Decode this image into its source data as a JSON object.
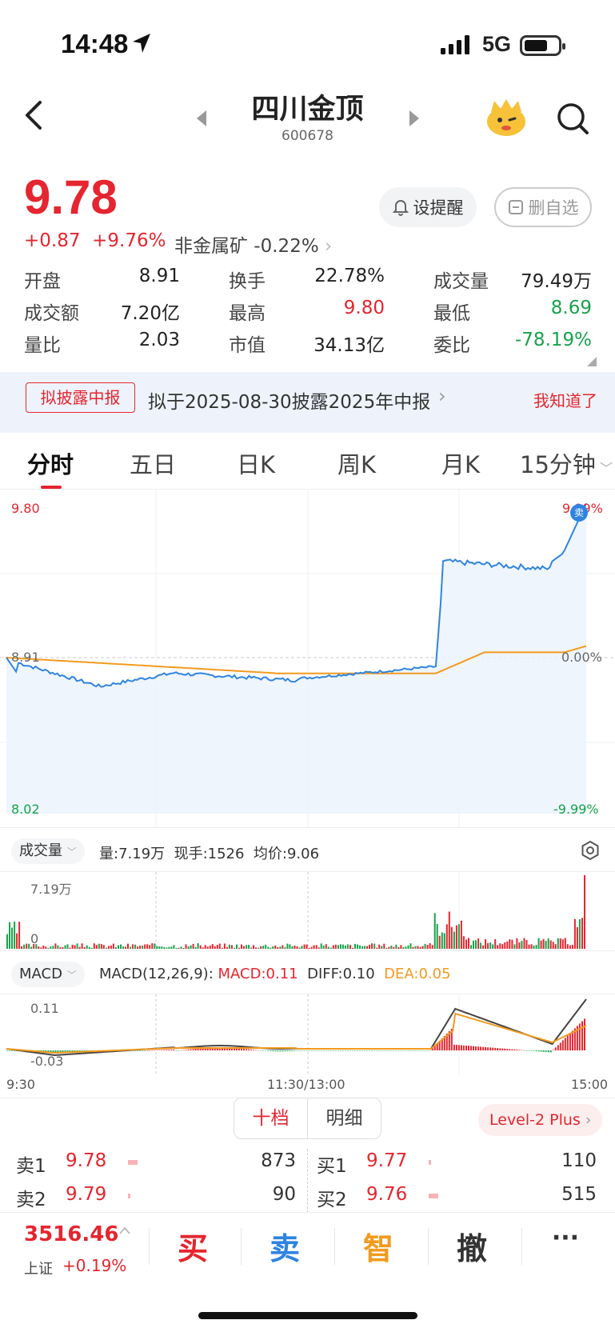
{
  "status": {
    "time": "14:48",
    "network": "5G"
  },
  "header": {
    "name": "四川金顶",
    "code": "600678"
  },
  "quote": {
    "price": "9.78",
    "change": "+0.87",
    "change_pct": "+9.76%",
    "sector": "非金属矿 -0.22%",
    "alert_label": "设提醒",
    "watch_label": "删自选"
  },
  "stats": [
    [
      {
        "label": "开盘",
        "value": "8.91",
        "color": "black"
      },
      {
        "label": "换手",
        "value": "22.78%",
        "color": "black"
      },
      {
        "label": "成交量",
        "value": "79.49万",
        "color": "black"
      }
    ],
    [
      {
        "label": "成交额",
        "value": "7.20亿",
        "color": "black"
      },
      {
        "label": "最高",
        "value": "9.80",
        "color": "red"
      },
      {
        "label": "最低",
        "value": "8.69",
        "color": "green"
      }
    ],
    [
      {
        "label": "量比",
        "value": "2.03",
        "color": "black"
      },
      {
        "label": "市值",
        "value": "34.13亿",
        "color": "black"
      },
      {
        "label": "委比",
        "value": "-78.19%",
        "color": "green"
      }
    ]
  ],
  "notice": {
    "badge": "拟披露中报",
    "text": "拟于2025-08-30披露2025年中报",
    "dismiss": "我知道了"
  },
  "tabs": [
    "分时",
    "五日",
    "日K",
    "周K",
    "月K",
    "15分钟"
  ],
  "chart": {
    "price_top": "9.80",
    "price_mid": "8.91",
    "price_bottom": "8.02",
    "pct_top": "9.99%",
    "pct_mid": "0.00%",
    "pct_bottom": "-9.99%",
    "sell_marker": "卖",
    "volume_selector": "成交量",
    "volume_info": "量:7.19万  现手:1526  均价:9.06",
    "volume_max": "7.19万",
    "volume_zero": "0",
    "macd_selector": "MACD",
    "macd_params": "MACD(12,26,9):",
    "macd_value": "MACD:0.11",
    "diff_value": "DIFF:0.10",
    "dea_value": "DEA:0.05",
    "macd_top": "0.11",
    "macd_bottom": "-0.03",
    "time_start": "9:30",
    "time_mid": "11:30/13:00",
    "time_end": "15:00"
  },
  "orderbook": {
    "toggle": [
      "十档",
      "明细"
    ],
    "level2": "Level-2 Plus",
    "asks": [
      {
        "label": "卖1",
        "price": "9.78",
        "vol": "873"
      },
      {
        "label": "卖2",
        "price": "9.79",
        "vol": "90"
      }
    ],
    "bids": [
      {
        "label": "买1",
        "price": "9.77",
        "vol": "110"
      },
      {
        "label": "买2",
        "price": "9.76",
        "vol": "515"
      }
    ]
  },
  "index": {
    "value": "3516.46",
    "name": "上证",
    "change": "+0.19%"
  },
  "actions": [
    "买",
    "卖",
    "智",
    "撤",
    "···"
  ],
  "colors": {
    "red": "#e5252f",
    "green": "#17a34a",
    "blue": "#2f84e0",
    "orange": "#f29a1f"
  }
}
